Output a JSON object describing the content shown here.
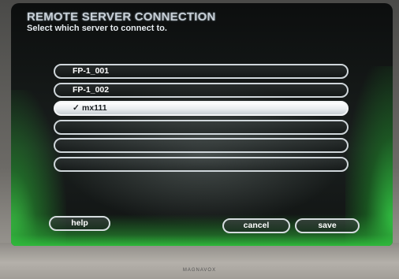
{
  "header": {
    "title": "REMOTE SERVER CONNECTION",
    "subtitle": "Select which server to connect to."
  },
  "servers": [
    {
      "label": "FP-1_001",
      "selected": false
    },
    {
      "label": "FP-1_002",
      "selected": false
    },
    {
      "label": "mx111",
      "selected": true
    },
    {
      "label": "",
      "selected": false
    },
    {
      "label": "",
      "selected": false
    },
    {
      "label": "",
      "selected": false
    }
  ],
  "selected_mark": "✓",
  "buttons": {
    "help": "help",
    "cancel": "cancel",
    "save": "save"
  },
  "brand": "MAGNAVOX",
  "colors": {
    "accent_glow": "#33c844",
    "selected_row": "#ffffff",
    "outline": "#cfd6da"
  }
}
